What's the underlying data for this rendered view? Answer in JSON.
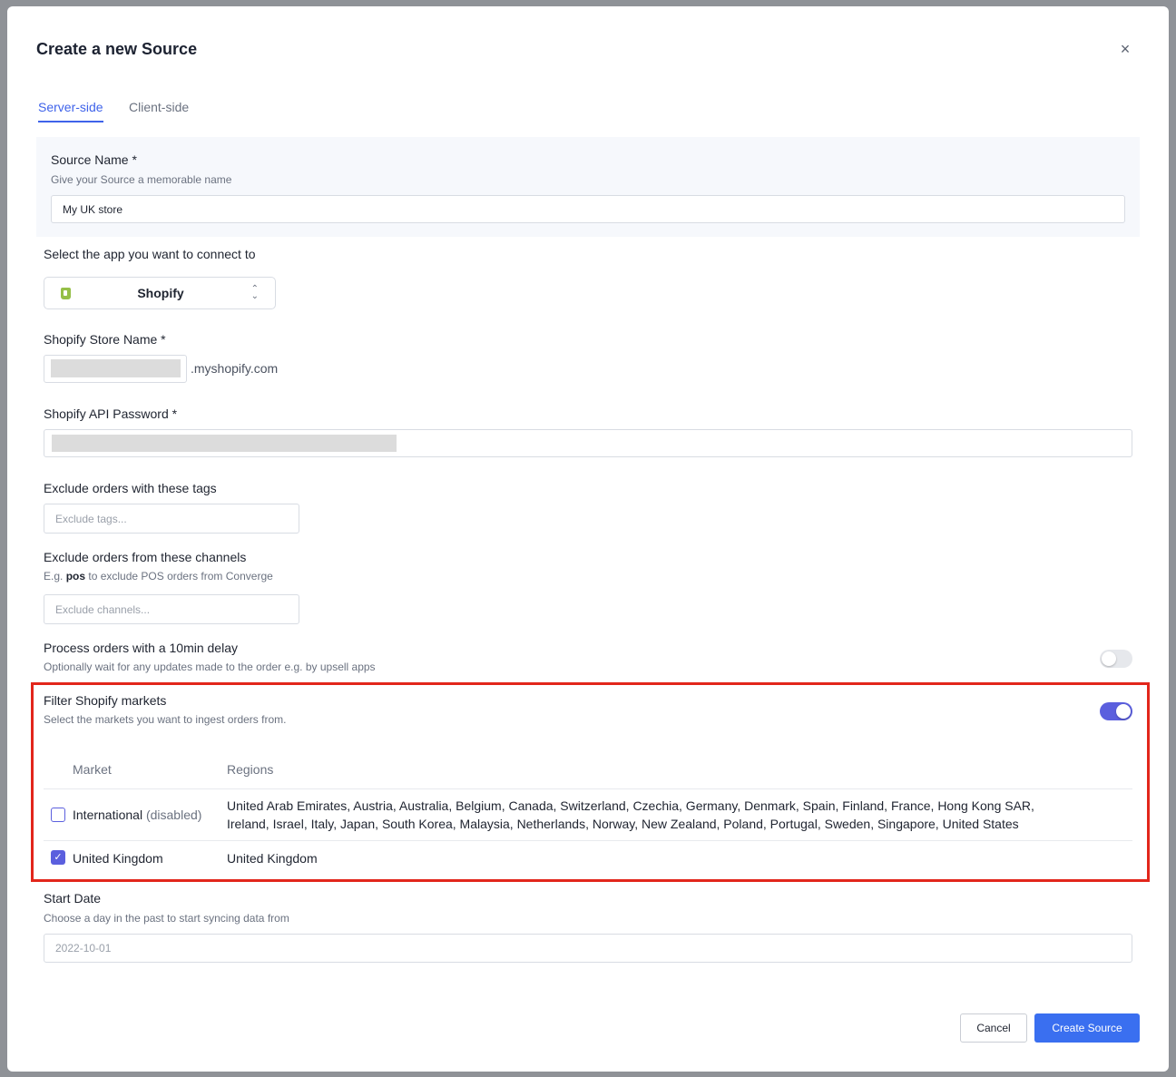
{
  "modal": {
    "title": "Create a new Source",
    "close_symbol": "×"
  },
  "tabs": [
    {
      "label": "Server-side",
      "active": true
    },
    {
      "label": "Client-side",
      "active": false
    }
  ],
  "source_name": {
    "label": "Source Name *",
    "help": "Give your Source a memorable name",
    "value": "My UK store"
  },
  "app_select": {
    "label": "Select the app you want to connect to",
    "value": "Shopify",
    "icon": "shopify-logo-icon"
  },
  "store_name": {
    "label": "Shopify Store Name *",
    "suffix": ".myshopify.com"
  },
  "api_password": {
    "label": "Shopify API Password *"
  },
  "exclude_tags": {
    "label": "Exclude orders with these tags",
    "placeholder": "Exclude tags..."
  },
  "exclude_channels": {
    "label": "Exclude orders from these channels",
    "help_prefix": "E.g. ",
    "help_code": "pos",
    "help_suffix": " to exclude POS orders from Converge",
    "placeholder": "Exclude channels..."
  },
  "delay": {
    "label": "Process orders with a 10min delay",
    "help": "Optionally wait for any updates made to the order e.g. by upsell apps",
    "enabled": false
  },
  "markets_filter": {
    "label": "Filter Shopify markets",
    "help": "Select the markets you want to ingest orders from.",
    "enabled": true,
    "columns": {
      "market": "Market",
      "regions": "Regions"
    },
    "rows": [
      {
        "market": "International",
        "status": "(disabled)",
        "checked": false,
        "regions_line1": "United Arab Emirates, Austria, Australia, Belgium, Canada, Switzerland, Czechia, Germany, Denmark, Spain, Finland, France, Hong Kong SAR,",
        "regions_line2": "Ireland, Israel, Italy, Japan, South Korea, Malaysia, Netherlands, Norway, New Zealand, Poland, Portugal, Sweden, Singapore, United States"
      },
      {
        "market": "United Kingdom",
        "checked": true,
        "regions_line1": "United Kingdom"
      }
    ]
  },
  "start_date": {
    "label": "Start Date",
    "help": "Choose a day in the past to start syncing data from",
    "placeholder": "2022-10-01"
  },
  "footer": {
    "cancel": "Cancel",
    "submit": "Create Source"
  },
  "colors": {
    "accent": "#3f63ea",
    "toggle_on": "#5b5fde",
    "primary_button": "#3a6ff0",
    "highlight_border": "#e2261b"
  }
}
